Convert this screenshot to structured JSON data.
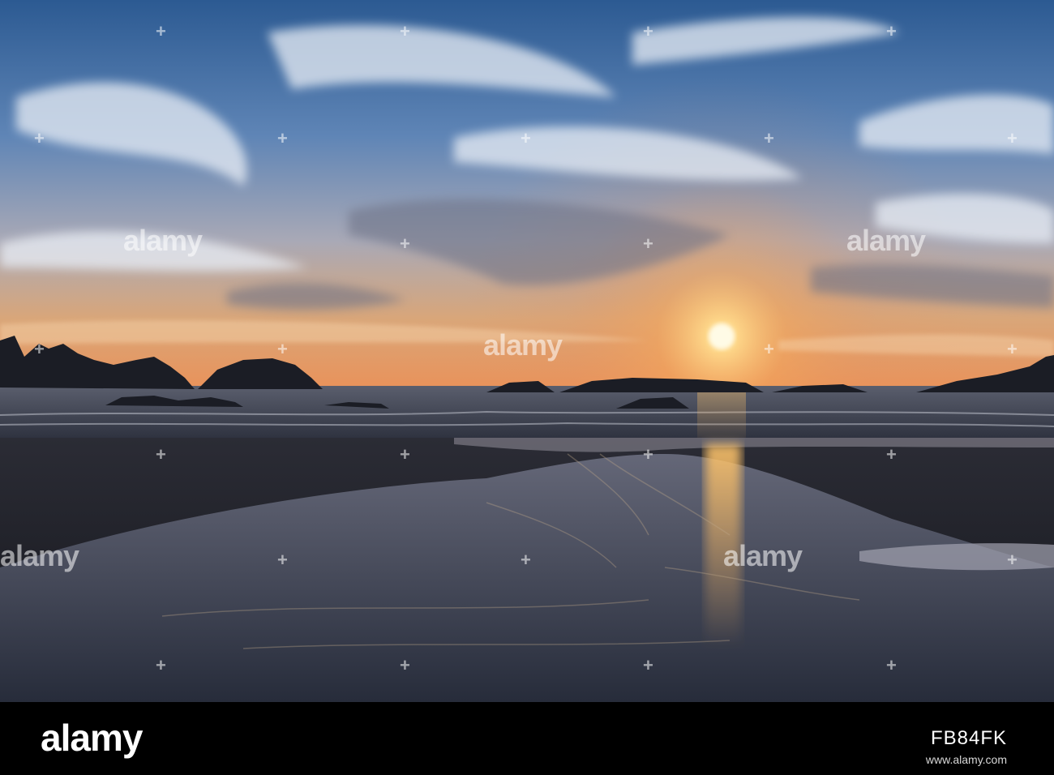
{
  "watermark": {
    "text": "alamy",
    "mark": "+"
  },
  "footer": {
    "logo": "alamy",
    "image_id": "FB84FK",
    "url": "www.alamy.com"
  },
  "scene": {
    "sky_top": "#2e5d95",
    "sky_mid": "#8fa8c6",
    "sky_glow": "#f2b26a",
    "sun": "#fff2c4",
    "water": "#3b4253",
    "sand": "#1a1b22"
  }
}
